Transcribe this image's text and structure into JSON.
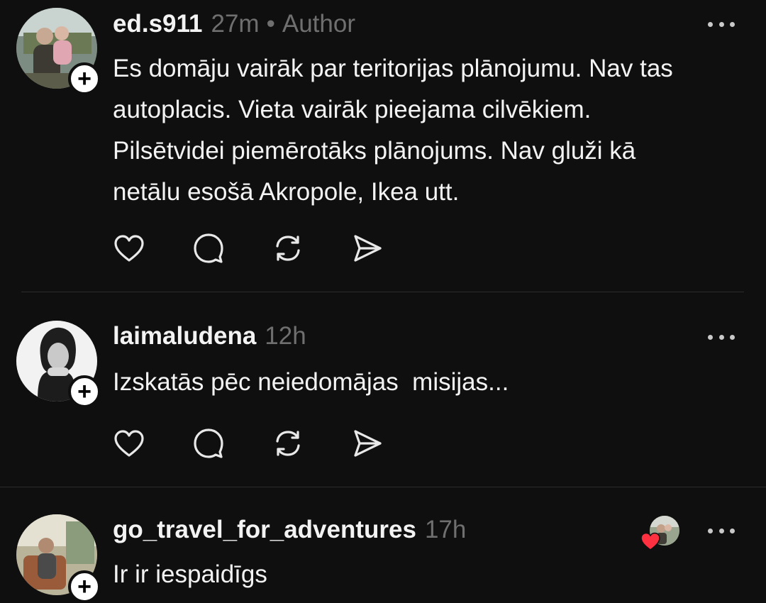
{
  "comments": [
    {
      "username": "ed.s911",
      "time": "27m",
      "separator": "•",
      "role": "Author",
      "text": [
        "Es domāju vairāk par teritorijas plānojumu. Nav tas",
        "autoplacis. Vieta vairāk pieejama cilvēkiem.",
        "Pilsētvidei piemērotāks plānojums. Nav gluži kā",
        "netālu esošā Akropole, Ikea utt."
      ],
      "actions": [
        "heart-icon",
        "comment-icon",
        "repost-icon",
        "share-icon"
      ]
    },
    {
      "username": "laimaludena",
      "time": "12h",
      "text": [
        "Izskatās pēc neiedomājas  misijas..."
      ],
      "actions": [
        "heart-icon",
        "comment-icon",
        "repost-icon",
        "share-icon"
      ]
    },
    {
      "username": "go_travel_for_adventures",
      "time": "17h",
      "text": [
        "Ir ir iespaidīgs"
      ],
      "liked_by_author": true
    }
  ],
  "colors": {
    "background": "#0f0f0f",
    "text": "#f3f3f3",
    "muted": "#6f6f6f",
    "heart": "#ff3040"
  }
}
